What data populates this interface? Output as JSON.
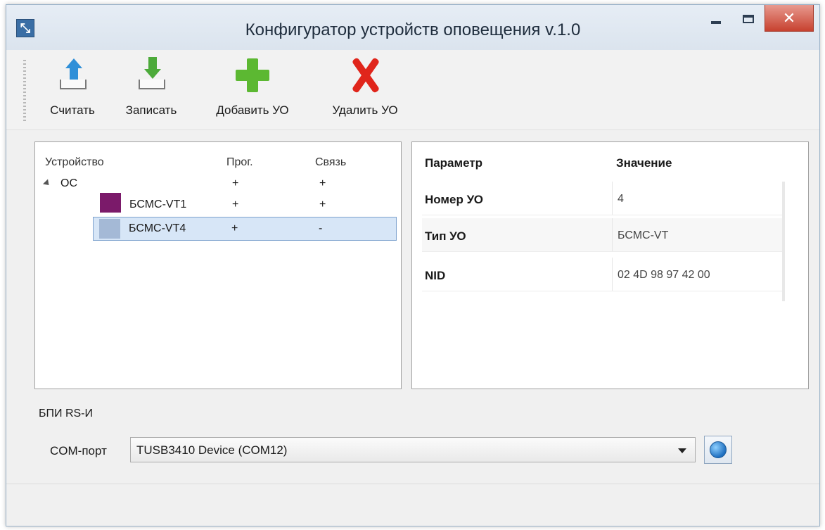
{
  "window": {
    "title": "Конфигуратор устройств оповещения v.1.0",
    "close_glyph": "✕"
  },
  "toolbar": {
    "read_label": "Считать",
    "write_label": "Записать",
    "add_label": "Добавить УО",
    "delete_label": "Удалить УО"
  },
  "tree": {
    "headers": {
      "device": "Устройство",
      "prog": "Прог.",
      "link": "Связь"
    },
    "root": {
      "label": "ОС",
      "prog": "+",
      "link": "+"
    },
    "children": [
      {
        "label": "БСМС-VT1",
        "prog": "+",
        "link": "+",
        "color": "#7b1a6a"
      },
      {
        "label": "БСМС-VT4",
        "prog": "+",
        "link": "-",
        "color": "#a4b9d6",
        "selected": true
      }
    ]
  },
  "properties": {
    "headers": {
      "param": "Параметр",
      "value": "Значение"
    },
    "rows": [
      {
        "name": "Номер УО",
        "value": "4"
      },
      {
        "name": "Тип УО",
        "value": "БСМС-VT"
      },
      {
        "name": "NID",
        "value": "02 4D 98 97 42 00"
      }
    ]
  },
  "port_group": {
    "label": "БПИ RS-И",
    "com_label": "COM-порт",
    "com_value": "TUSB3410 Device (COM12)"
  },
  "colors": {
    "accent": "#3a6ea5",
    "selection": "#d7e6f7",
    "close": "#c7412f"
  }
}
